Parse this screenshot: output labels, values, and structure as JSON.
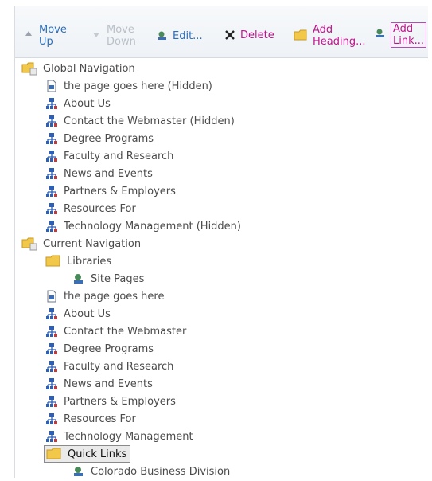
{
  "toolbar": {
    "move_up": {
      "line1": "Move",
      "line2": "Up"
    },
    "move_down": {
      "line1": "Move",
      "line2": "Down"
    },
    "edit": "Edit...",
    "delete": "Delete",
    "add_heading": {
      "line1": "Add",
      "line2": "Heading..."
    },
    "add_link": {
      "line1": "Add",
      "line2": "Link..."
    }
  },
  "tree": {
    "global": "Global Navigation",
    "global_items": [
      "the page goes here (Hidden)",
      "About Us",
      "Contact the Webmaster (Hidden)",
      "Degree Programs",
      "Faculty and Research",
      "News and Events",
      "Partners & Employers",
      "Resources For",
      "Technology Management (Hidden)"
    ],
    "current": "Current Navigation",
    "libraries": "Libraries",
    "site_pages": "Site Pages",
    "current_items": [
      "the page goes here",
      "About Us",
      "Contact the Webmaster",
      "Degree Programs",
      "Faculty and Research",
      "News and Events",
      "Partners & Employers",
      "Resources For",
      "Technology Management"
    ],
    "quick_links": "Quick Links",
    "colorado": "Colorado Business Division"
  },
  "icons": {
    "folder_color": "#f2c84b",
    "nav_icon_color": "#2f5fb3",
    "link_color": "#3a8a4a"
  }
}
